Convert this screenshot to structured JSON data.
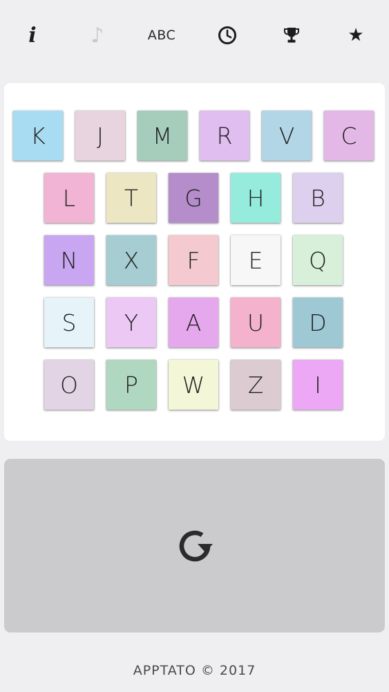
{
  "toolbar": {
    "info_glyph": "i",
    "music_glyph": "♪",
    "abc_label": "ABC",
    "star_glyph": "★",
    "icons": [
      "info-icon",
      "music-note-icon",
      "abc-mode-button",
      "clock-icon",
      "trophy-icon",
      "star-icon"
    ]
  },
  "board": {
    "tiles": [
      {
        "letter": "K",
        "color": "#a8dcf2"
      },
      {
        "letter": "J",
        "color": "#e8d4df"
      },
      {
        "letter": "M",
        "color": "#a6cdbc"
      },
      {
        "letter": "R",
        "color": "#e0bef0"
      },
      {
        "letter": "V",
        "color": "#b2d6e6"
      },
      {
        "letter": "C",
        "color": "#e4b8e6"
      },
      {
        "letter": "L",
        "color": "#f2b4d4"
      },
      {
        "letter": "T",
        "color": "#ece6c2"
      },
      {
        "letter": "G",
        "color": "#b48dca"
      },
      {
        "letter": "H",
        "color": "#96ecdc"
      },
      {
        "letter": "B",
        "color": "#dcd0ee"
      },
      {
        "letter": "N",
        "color": "#c8a6f2"
      },
      {
        "letter": "X",
        "color": "#a6cdd2"
      },
      {
        "letter": "F",
        "color": "#f4cad0"
      },
      {
        "letter": "E",
        "color": "#f7f7f7"
      },
      {
        "letter": "Q",
        "color": "#d8f0da"
      },
      {
        "letter": "S",
        "color": "#e6f4fa"
      },
      {
        "letter": "Y",
        "color": "#ecc8f4"
      },
      {
        "letter": "A",
        "color": "#e6a8ec"
      },
      {
        "letter": "U",
        "color": "#f4b2cc"
      },
      {
        "letter": "D",
        "color": "#9ec8d4"
      },
      {
        "letter": "O",
        "color": "#e2d4e4"
      },
      {
        "letter": "P",
        "color": "#b0d8c0"
      },
      {
        "letter": "W",
        "color": "#f4f6d8"
      },
      {
        "letter": "Z",
        "color": "#dcccd2"
      },
      {
        "letter": "I",
        "color": "#eca8f4"
      }
    ]
  },
  "reset": {
    "icon": "refresh-icon"
  },
  "footer": {
    "text": "APPTATO © 2017"
  }
}
